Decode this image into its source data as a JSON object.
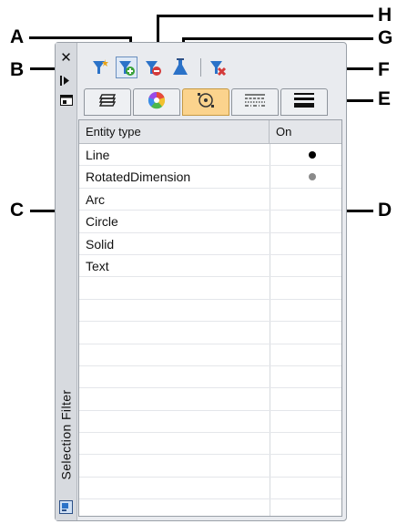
{
  "callouts": {
    "a": "A",
    "b": "B",
    "c": "C",
    "d": "D",
    "e": "E",
    "f": "F",
    "g": "G",
    "h": "H"
  },
  "palette": {
    "title": "Selection Filter",
    "close_icon": "close-icon",
    "colors": {
      "frame": "#e9ebef",
      "selected_tab": "#fbd38d",
      "accent": "#2b72c8"
    }
  },
  "toolbar": {
    "items": [
      {
        "icon": "filter-star-icon"
      },
      {
        "icon": "filter-add-icon"
      },
      {
        "icon": "filter-remove-icon"
      },
      {
        "icon": "flask-icon"
      },
      {
        "icon": "filter-clear-icon"
      }
    ]
  },
  "tabs": {
    "items": [
      {
        "icon": "layers-icon"
      },
      {
        "icon": "color-wheel-icon"
      },
      {
        "icon": "linetype-icon",
        "selected": true
      },
      {
        "icon": "line-style-icon"
      },
      {
        "icon": "lineweight-icon"
      }
    ]
  },
  "grid": {
    "columns": [
      "Entity type",
      "On"
    ],
    "rows": [
      {
        "name": "Line",
        "on": "black"
      },
      {
        "name": "RotatedDimension",
        "on": "gray"
      },
      {
        "name": "Arc",
        "on": ""
      },
      {
        "name": "Circle",
        "on": ""
      },
      {
        "name": "Solid",
        "on": ""
      },
      {
        "name": "Text",
        "on": ""
      }
    ]
  }
}
